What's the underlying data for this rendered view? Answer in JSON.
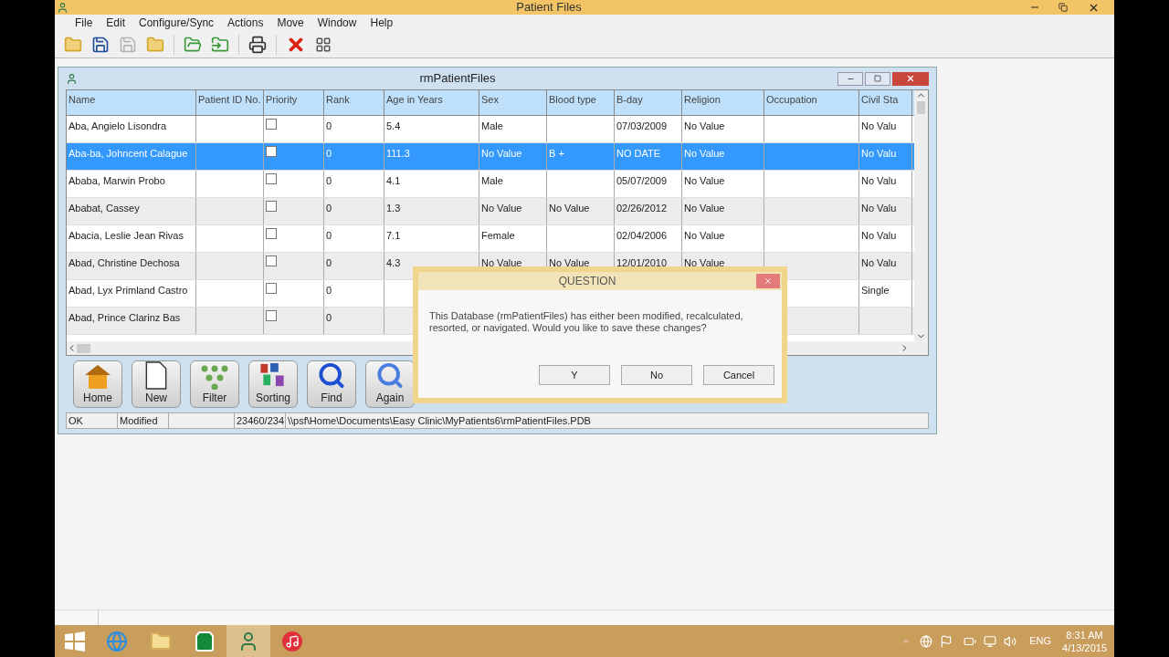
{
  "app": {
    "title": "Patient Files",
    "menu": [
      "File",
      "Edit",
      "Configure/Sync",
      "Actions",
      "Move",
      "Window",
      "Help"
    ]
  },
  "child_window": {
    "title": "rmPatientFiles"
  },
  "table": {
    "columns": [
      {
        "label": "Name",
        "kind": "text"
      },
      {
        "label": "Patient ID No.",
        "kind": "text"
      },
      {
        "label": "Priority",
        "kind": "checkbox"
      },
      {
        "label": "Rank",
        "kind": "text"
      },
      {
        "label": "Age in Years",
        "kind": "text"
      },
      {
        "label": "Sex",
        "kind": "text"
      },
      {
        "label": "Blood type",
        "kind": "text"
      },
      {
        "label": "B-day",
        "kind": "text"
      },
      {
        "label": "Religion",
        "kind": "text"
      },
      {
        "label": "Occupation",
        "kind": "text"
      },
      {
        "label": "Civil Sta",
        "kind": "text"
      }
    ],
    "rows": [
      {
        "selected": false,
        "cells": [
          "Aba, Angielo Lisondra",
          null,
          false,
          "0",
          "5.4",
          "Male",
          null,
          "07/03/2009",
          "No Value",
          null,
          "No Valu"
        ]
      },
      {
        "selected": true,
        "cells": [
          "Aba-ba, Johncent Calague",
          null,
          false,
          "0",
          "111.3",
          "No Value",
          "B +",
          "NO DATE",
          "No Value",
          null,
          "No Valu"
        ]
      },
      {
        "selected": false,
        "cells": [
          "Ababa, Marwin Probo",
          null,
          false,
          "0",
          "4.1",
          "Male",
          null,
          "05/07/2009",
          "No Value",
          null,
          "No Valu"
        ]
      },
      {
        "selected": false,
        "cells": [
          "Ababat, Cassey",
          null,
          false,
          "0",
          "1.3",
          "No Value",
          "No Value",
          "02/26/2012",
          "No Value",
          null,
          "No Valu"
        ]
      },
      {
        "selected": false,
        "cells": [
          "Abacia, Leslie Jean Rivas",
          null,
          false,
          "0",
          "7.1",
          "Female",
          null,
          "02/04/2006",
          "No Value",
          null,
          "No Valu"
        ]
      },
      {
        "selected": false,
        "cells": [
          "Abad, Christine Dechosa",
          null,
          false,
          "0",
          "4.3",
          "No Value",
          "No Value",
          "12/01/2010",
          "No Value",
          null,
          "No Valu"
        ]
      },
      {
        "selected": false,
        "cells": [
          "Abad, Lyx Primland Castro",
          null,
          false,
          "0",
          null,
          null,
          null,
          null,
          null,
          null,
          "Single"
        ]
      },
      {
        "selected": false,
        "cells": [
          "Abad, Prince Clarinz Bas",
          null,
          false,
          "0",
          null,
          null,
          null,
          null,
          null,
          null,
          null
        ]
      }
    ]
  },
  "tools": [
    {
      "kind": "home",
      "label": "Home"
    },
    {
      "kind": "new",
      "label": "New"
    },
    {
      "kind": "filter",
      "label": "Filter"
    },
    {
      "kind": "sorting",
      "label": "Sorting"
    },
    {
      "kind": "find",
      "label": "Find"
    },
    {
      "kind": "again",
      "label": "Again"
    }
  ],
  "status_bar": [
    "OK",
    "Modified",
    "23460/234",
    "\\\\psf\\Home\\Documents\\Easy Clinic\\MyPatients6\\rmPatientFiles.PDB"
  ],
  "dialog": {
    "title": "QUESTION",
    "message": "This Database (rmPatientFiles) has either been modified, recalculated, resorted, or navigated.  Would you like to save these changes?",
    "buttons": [
      "Y",
      "No",
      "Cancel"
    ]
  },
  "tray": {
    "language": "ENG",
    "time": "8:31 AM",
    "date": "4/13/2015"
  }
}
